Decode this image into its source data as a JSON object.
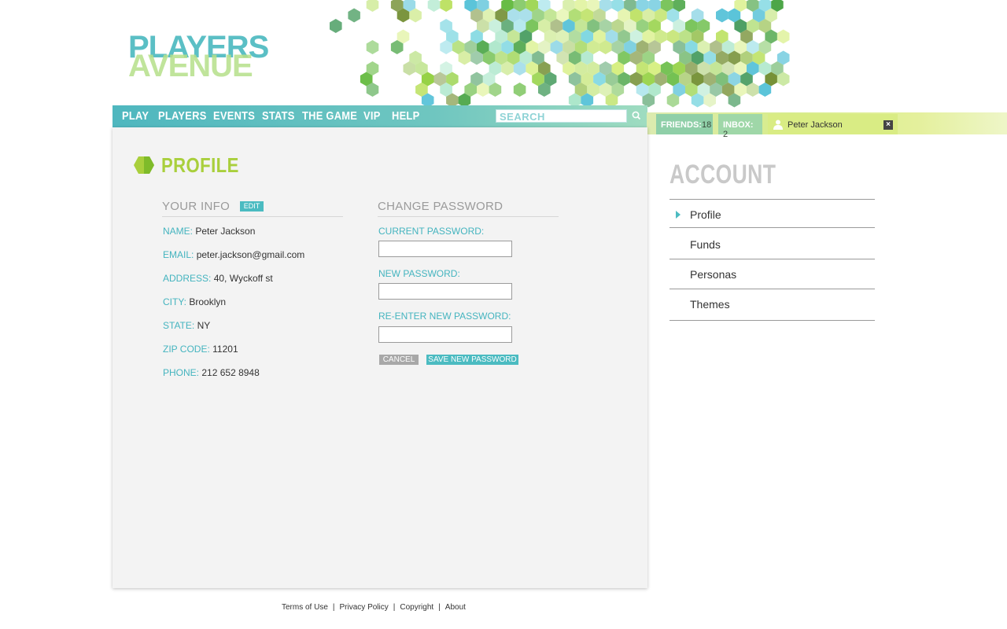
{
  "brand": {
    "line1": "PLAYERS",
    "line2": "AVENUE"
  },
  "nav": {
    "items": [
      "PLAY",
      "PLAYERS",
      "EVENTS",
      "STATS",
      "THE GAME",
      "VIP",
      "HELP"
    ],
    "search_placeholder": "SEARCH"
  },
  "status": {
    "friends_label": "FRIENDS:",
    "friends_count": "18",
    "inbox_label": "INBOX:",
    "inbox_count": "2",
    "user_name": "Peter Jackson"
  },
  "profile": {
    "title": "PROFILE",
    "your_info": {
      "heading": "YOUR INFO",
      "edit_label": "EDIT",
      "fields": [
        {
          "label": "NAME:",
          "value": "Peter Jackson"
        },
        {
          "label": "EMAIL:",
          "value": "peter.jackson@gmail.com"
        },
        {
          "label": "ADDRESS:",
          "value": "40, Wyckoff st"
        },
        {
          "label": "CITY:",
          "value": "Brooklyn"
        },
        {
          "label": "STATE:",
          "value": "NY"
        },
        {
          "label": "ZIP CODE:",
          "value": "11201"
        },
        {
          "label": "PHONE:",
          "value": "212 652 8948"
        }
      ]
    },
    "change_password": {
      "heading": "CHANGE PASSWORD",
      "current_label": "CURRENT PASSWORD:",
      "new_label": "NEW PASSWORD:",
      "reenter_label": "RE-ENTER NEW PASSWORD:",
      "cancel_label": "CANCEL",
      "save_label": "SAVE NEW PASSWORD"
    }
  },
  "account": {
    "title": "ACCOUNT",
    "items": [
      "Profile",
      "Funds",
      "Personas",
      "Themes"
    ],
    "selected": "Profile"
  },
  "footer": {
    "links": [
      "Terms of Use",
      "Privacy Policy",
      "Copyright",
      "About"
    ]
  },
  "colors": {
    "teal": "#4bbbc1",
    "lime": "#a9cf3c",
    "strip": "#d9ec84"
  }
}
